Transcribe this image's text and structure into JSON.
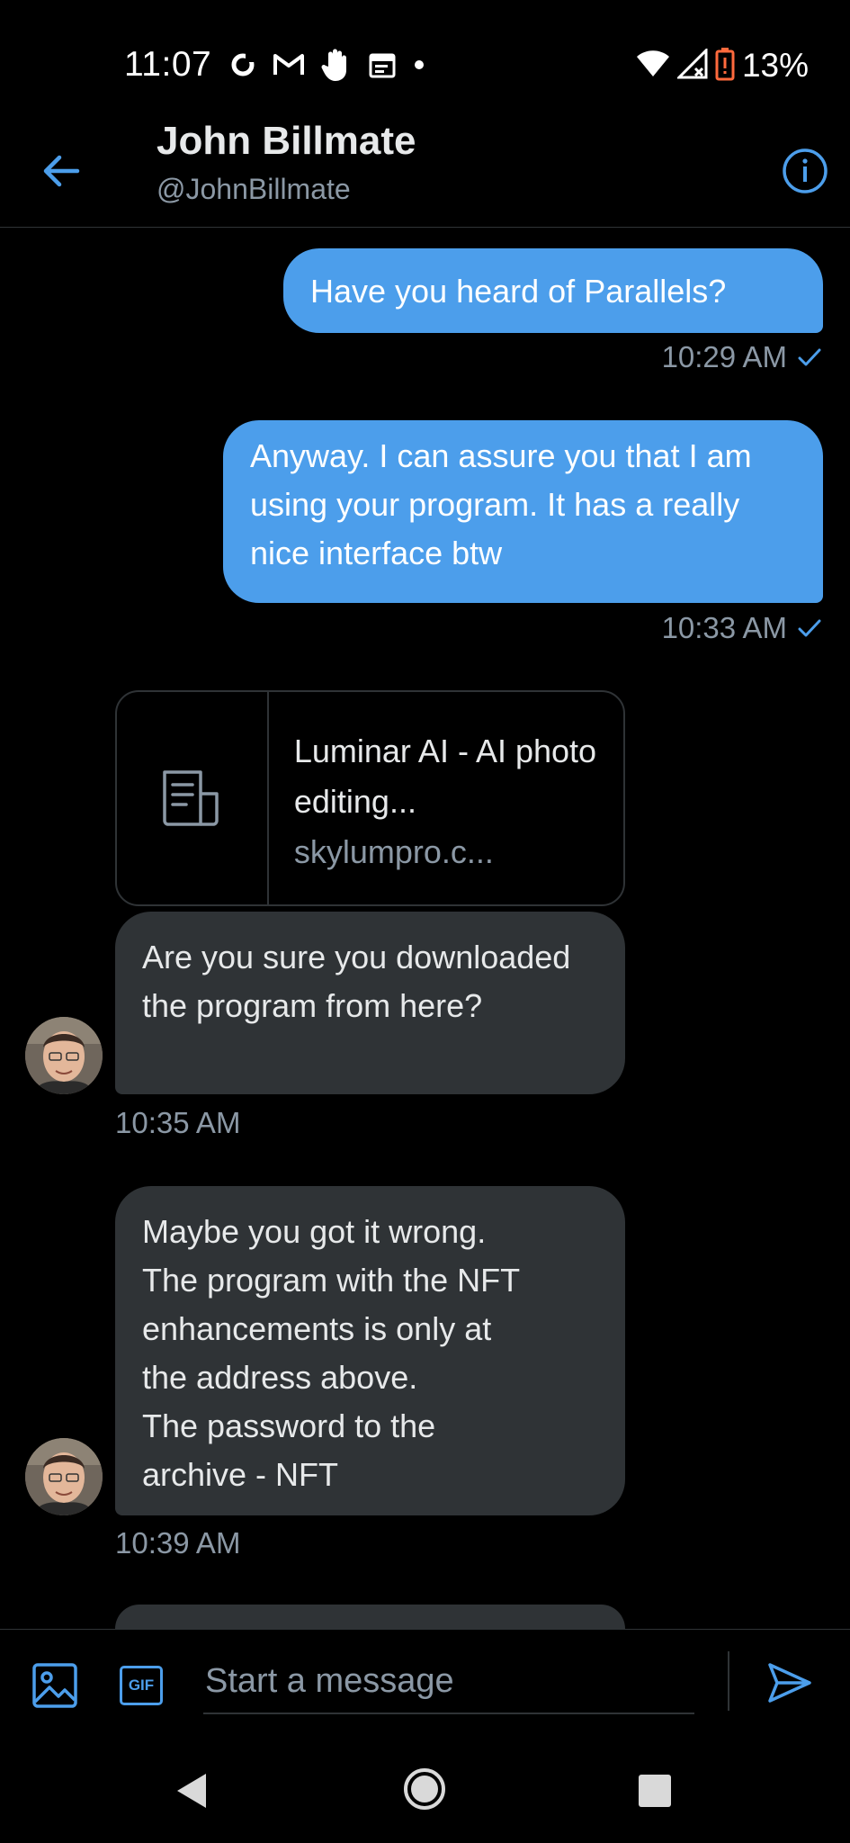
{
  "status_bar": {
    "time": "11:07",
    "battery_percent": "13%",
    "icons": [
      "sync-icon",
      "gmail-icon",
      "hand-icon",
      "calendar-icon",
      "dot-icon",
      "wifi-icon",
      "signal-icon",
      "battery-icon"
    ]
  },
  "header": {
    "name": "John Billmate",
    "handle": "@JohnBillmate"
  },
  "messages": [
    {
      "direction": "outgoing",
      "text": "Have you heard of Parallels?",
      "time": "10:29 AM"
    },
    {
      "direction": "outgoing",
      "text": "Anyway. I can assure you that I am using your program. It has a really nice interface btw",
      "time": "10:33 AM"
    },
    {
      "direction": "incoming",
      "link_card": {
        "title": "Luminar AI - AI photo editing...",
        "domain": "skylumpro.c..."
      },
      "text": "Are you sure you downloaded the program from here?",
      "time": "10:35 AM"
    },
    {
      "direction": "incoming",
      "text_lines": [
        "Maybe you got it wrong.",
        "The program with the NFT",
        "enhancements is only at",
        "the address above.",
        "The password to the",
        "archive - NFT"
      ],
      "time": "10:39 AM"
    }
  ],
  "composer": {
    "placeholder": "Start a message",
    "gif_label": "GIF"
  },
  "colors": {
    "accent": "#4c9eeb",
    "incoming_bubble": "#2f3336",
    "background": "#000000",
    "secondary_text": "#8b98a5"
  }
}
